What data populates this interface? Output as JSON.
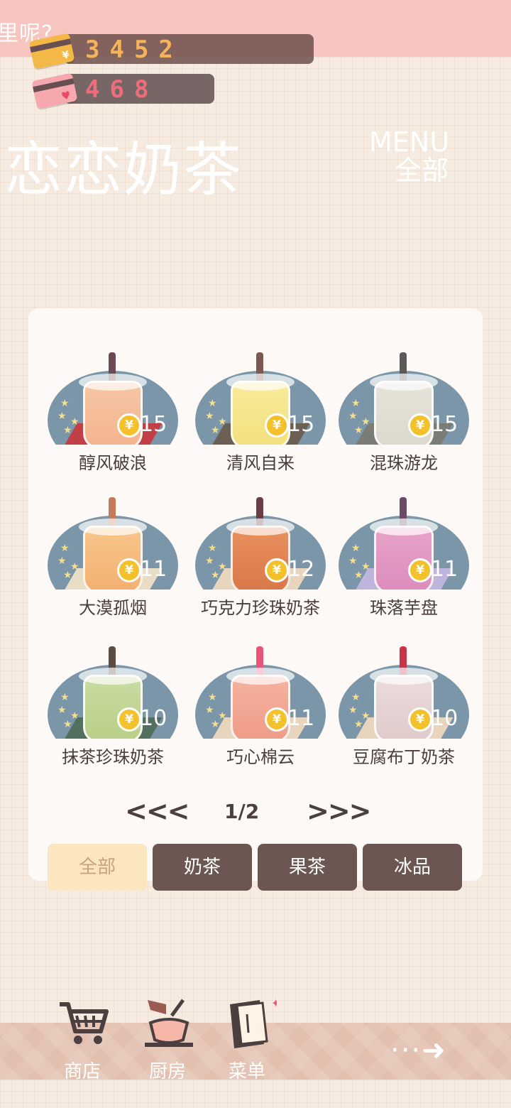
{
  "top_hint": "里呢?",
  "currency": {
    "money": "3452",
    "hearts": "468"
  },
  "shop_title": "恋恋奶茶",
  "menu_label": {
    "line1": "MENU",
    "line2": "全部"
  },
  "items": [
    {
      "name": "醇风破浪",
      "price": "15",
      "cup_color": "#f6c6a4",
      "drink_color": "#f3b48f",
      "straw_color": "#6b4a55",
      "mat_color": "#c9353a"
    },
    {
      "name": "清风自来",
      "price": "15",
      "cup_color": "#f7ea9b",
      "drink_color": "#f3e07d",
      "straw_color": "#7a5a50",
      "mat_color": "#6a5a4a"
    },
    {
      "name": "混珠游龙",
      "price": "15",
      "cup_color": "#e6e3da",
      "drink_color": "#dcd8cc",
      "straw_color": "#5c5a58",
      "mat_color": "#7a7a70"
    },
    {
      "name": "大漠孤烟",
      "price": "11",
      "cup_color": "#f8c58a",
      "drink_color": "#f3b070",
      "straw_color": "#c47b5a",
      "mat_color": "#f3e6c8"
    },
    {
      "name": "巧克力珍珠奶茶",
      "price": "12",
      "cup_color": "#e8915f",
      "drink_color": "#d9784a",
      "straw_color": "#6b3d44",
      "mat_color": "#f3dcc0"
    },
    {
      "name": "珠落芋盘",
      "price": "11",
      "cup_color": "#e7a3c8",
      "drink_color": "#dd8cbc",
      "straw_color": "#6a4a66",
      "mat_color": "#c5b8e2"
    },
    {
      "name": "抹茶珍珠奶茶",
      "price": "10",
      "cup_color": "#c9dba2",
      "drink_color": "#b9cf88",
      "straw_color": "#5c4c42",
      "mat_color": "#4e6a58"
    },
    {
      "name": "巧心棉云",
      "price": "11",
      "cup_color": "#f5b2a0",
      "drink_color": "#ee9c86",
      "straw_color": "#e9547a",
      "mat_color": "#f3dcc0"
    },
    {
      "name": "豆腐布丁奶茶",
      "price": "10",
      "cup_color": "#ebdcdc",
      "drink_color": "#dfcaca",
      "straw_color": "#c73448",
      "mat_color": "#f3dcc0"
    }
  ],
  "coin_symbol": "¥",
  "pager": {
    "prev": "<<<",
    "current": "1/2",
    "next": ">>>"
  },
  "filters": [
    {
      "label": "全部",
      "active": true
    },
    {
      "label": "奶茶",
      "active": false
    },
    {
      "label": "果茶",
      "active": false
    },
    {
      "label": "冰品",
      "active": false
    }
  ],
  "nav": [
    {
      "label": "商店",
      "icon": "cart-icon"
    },
    {
      "label": "厨房",
      "icon": "kitchen-icon"
    },
    {
      "label": "菜单",
      "icon": "menu-book-icon"
    }
  ],
  "next_arrow": "···➜"
}
